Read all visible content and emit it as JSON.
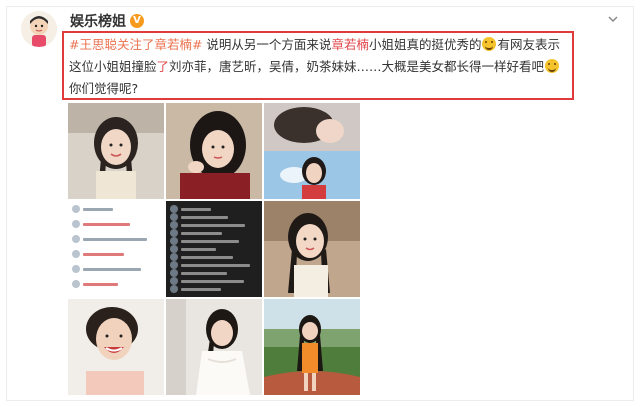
{
  "post": {
    "username": "娱乐榜姐",
    "badge": "V",
    "text_parts": [
      {
        "t": "#王思聪关注了章若楠#",
        "c": "tag"
      },
      {
        "t": " 说明从另一个方面来说",
        "c": ""
      },
      {
        "t": "章若楠",
        "c": "hl"
      },
      {
        "t": "小姐姐真的挺优秀的",
        "c": ""
      },
      {
        "t": "EMOJI",
        "c": "emoji"
      },
      {
        "t": "有网友表示这位小姐姐撞脸",
        "c": ""
      },
      {
        "t": "了",
        "c": "hl"
      },
      {
        "t": "刘亦菲，唐艺昕，吴倩，奶茶妹妹……大概是美女都长得一样好看吧",
        "c": ""
      },
      {
        "t": "EMOJI",
        "c": "emoji"
      },
      {
        "t": "你们觉得呢?",
        "c": ""
      }
    ]
  },
  "images": [
    {
      "name": "photo-1-girl-smiling-braids"
    },
    {
      "name": "photo-2-girl-black-hair"
    },
    {
      "name": "photo-3-collage-girl-sky"
    },
    {
      "name": "photo-4-chat-screenshot-light"
    },
    {
      "name": "photo-5-chat-screenshot-dark"
    },
    {
      "name": "photo-6-girl-braids-outdoor"
    },
    {
      "name": "photo-7-woman-laughing"
    },
    {
      "name": "photo-8-girl-white-dress"
    },
    {
      "name": "photo-9-girl-running-track"
    }
  ],
  "colors": {
    "tag": "#eb7350",
    "highlight": "#e1484b",
    "box_border": "#e03a3a",
    "verified": "#f79a1e"
  },
  "icons": [
    "avatar",
    "verified-badge-icon",
    "chevron-down-icon",
    "laugh-emoji-icon"
  ]
}
